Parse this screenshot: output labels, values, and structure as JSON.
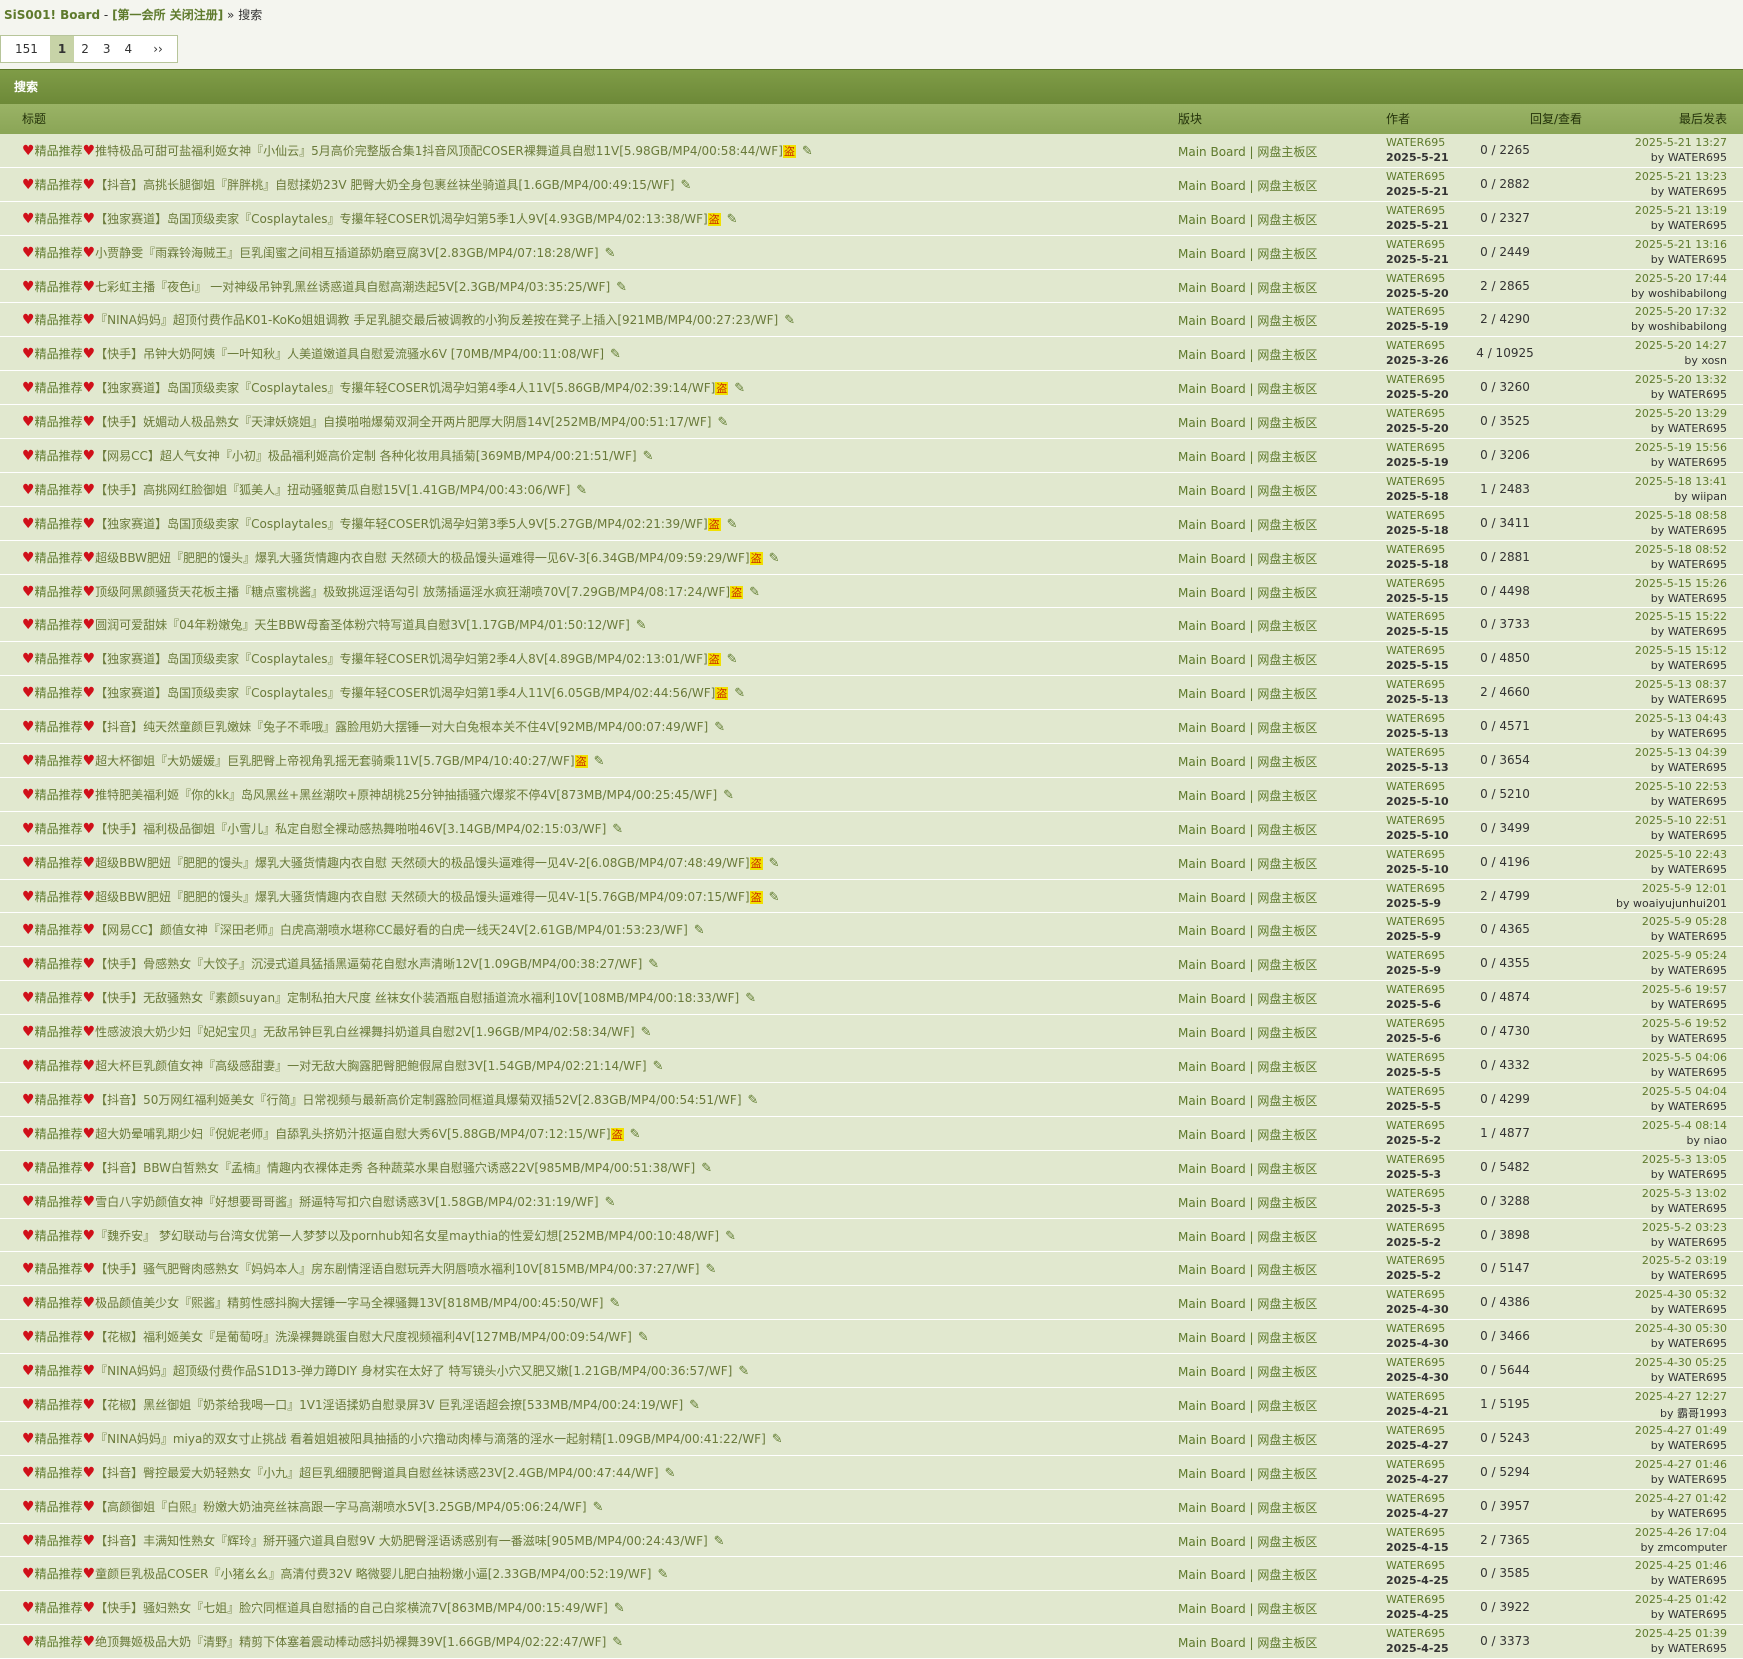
{
  "breadcrumb": {
    "site": "SiS001! Board",
    "sep1": " - ",
    "forum": "[第一会所 关闭注册]",
    "sep2": " » ",
    "current": "搜索"
  },
  "pager": {
    "total": "151",
    "current": "1",
    "pages": [
      "2",
      "3",
      "4"
    ],
    "next": "››"
  },
  "section_title": "搜索",
  "columns": {
    "title": "标题",
    "forum": "版块",
    "author": "作者",
    "stats": "回复/查看",
    "last": "最后发表"
  },
  "row_prefix": "精品推荐",
  "forum_label": "Main Board | 网盘主板区",
  "rows": [
    {
      "title": "推特极品可甜可盐福利姬女神『小仙云』5月高价完整版合集1抖音风顶配COSER裸舞道具自慰11V[5.98GB/MP4/00:58:44/WF]",
      "tag": "盗",
      "author": "WATER695",
      "date": "2025-5-21",
      "stats": "0 / 2265",
      "last_time": "2025-5-21 13:27",
      "last_by": "by WATER695"
    },
    {
      "title": "【抖音】高挑长腿御姐『胖胖桃』自慰揉奶23V 肥臀大奶全身包裹丝袜坐骑道具[1.6GB/MP4/00:49:15/WF]",
      "tag": "",
      "author": "WATER695",
      "date": "2025-5-21",
      "stats": "0 / 2882",
      "last_time": "2025-5-21 13:23",
      "last_by": "by WATER695"
    },
    {
      "title": "【独家赛道】岛国顶级卖家『Cosplaytales』专攥年轻COSER饥渴孕妇第5季1人9V[4.93GB/MP4/02:13:38/WF]",
      "tag": "盗",
      "author": "WATER695",
      "date": "2025-5-21",
      "stats": "0 / 2327",
      "last_time": "2025-5-21 13:19",
      "last_by": "by WATER695"
    },
    {
      "title": "小贾静雯『雨霖铃海贼王』巨乳闺蜜之间相互插道舔奶磨豆腐3V[2.83GB/MP4/07:18:28/WF]",
      "tag": "",
      "author": "WATER695",
      "date": "2025-5-21",
      "stats": "0 / 2449",
      "last_time": "2025-5-21 13:16",
      "last_by": "by WATER695"
    },
    {
      "title": "七彩虹主播『夜色i』 一对神级吊钟乳黑丝诱惑道具自慰高潮迭起5V[2.3GB/MP4/03:35:25/WF]",
      "tag": "",
      "author": "WATER695",
      "date": "2025-5-20",
      "stats": "2 / 2865",
      "last_time": "2025-5-20 17:44",
      "last_by": "by woshibabilong"
    },
    {
      "title": "『NINA妈妈』超顶付费作品K01-KoKo姐姐调教 手足乳腿交最后被调教的小狗反差按在凳子上插入[921MB/MP4/00:27:23/WF]",
      "tag": "",
      "author": "WATER695",
      "date": "2025-5-19",
      "stats": "2 / 4290",
      "last_time": "2025-5-20 17:32",
      "last_by": "by woshibabilong"
    },
    {
      "title": "【快手】吊钟大奶阿姨『一叶知秋』人美道嫩道具自慰爱流骚水6V [70MB/MP4/00:11:08/WF]",
      "tag": "",
      "author": "WATER695",
      "date": "2025-3-26",
      "stats": "4 / 10925",
      "last_time": "2025-5-20 14:27",
      "last_by": "by xosn"
    },
    {
      "title": "【独家赛道】岛国顶级卖家『Cosplaytales』专攥年轻COSER饥渴孕妇第4季4人11V[5.86GB/MP4/02:39:14/WF]",
      "tag": "盗",
      "author": "WATER695",
      "date": "2025-5-20",
      "stats": "0 / 3260",
      "last_time": "2025-5-20 13:32",
      "last_by": "by WATER695"
    },
    {
      "title": "【快手】妩媚动人极品熟女『天津妖娆姐』自摸啪啪爆菊双洞全开两片肥厚大阴唇14V[252MB/MP4/00:51:17/WF]",
      "tag": "",
      "author": "WATER695",
      "date": "2025-5-20",
      "stats": "0 / 3525",
      "last_time": "2025-5-20 13:29",
      "last_by": "by WATER695"
    },
    {
      "title": "【网易CC】超人气女神『小初』极品福利姬高价定制 各种化妆用具插菊[369MB/MP4/00:21:51/WF]",
      "tag": "",
      "author": "WATER695",
      "date": "2025-5-19",
      "stats": "0 / 3206",
      "last_time": "2025-5-19 15:56",
      "last_by": "by WATER695"
    },
    {
      "title": "【快手】高挑网红脸御姐『狐美人』扭动骚躯黄瓜自慰15V[1.41GB/MP4/00:43:06/WF]",
      "tag": "",
      "author": "WATER695",
      "date": "2025-5-18",
      "stats": "1 / 2483",
      "last_time": "2025-5-18 13:41",
      "last_by": "by wiipan"
    },
    {
      "title": "【独家赛道】岛国顶级卖家『Cosplaytales』专攥年轻COSER饥渴孕妇第3季5人9V[5.27GB/MP4/02:21:39/WF]",
      "tag": "盗",
      "author": "WATER695",
      "date": "2025-5-18",
      "stats": "0 / 3411",
      "last_time": "2025-5-18 08:58",
      "last_by": "by WATER695"
    },
    {
      "title": "超级BBW肥妞『肥肥的馒头』爆乳大骚货情趣内衣自慰 天然硕大的极品馒头逼难得一见6V-3[6.34GB/MP4/09:59:29/WF]",
      "tag": "盗",
      "author": "WATER695",
      "date": "2025-5-18",
      "stats": "0 / 2881",
      "last_time": "2025-5-18 08:52",
      "last_by": "by WATER695"
    },
    {
      "title": "顶级阿黑颜骚货天花板主播『糖点蜜桃酱』极致挑逗淫语勾引 放荡插逼淫水疯狂潮喷70V[7.29GB/MP4/08:17:24/WF]",
      "tag": "盗",
      "author": "WATER695",
      "date": "2025-5-15",
      "stats": "0 / 4498",
      "last_time": "2025-5-15 15:26",
      "last_by": "by WATER695"
    },
    {
      "title": "圆润可爱甜妹『04年粉嫩兔』天生BBW母畜圣体粉穴特写道具自慰3V[1.17GB/MP4/01:50:12/WF]",
      "tag": "",
      "author": "WATER695",
      "date": "2025-5-15",
      "stats": "0 / 3733",
      "last_time": "2025-5-15 15:22",
      "last_by": "by WATER695"
    },
    {
      "title": "【独家赛道】岛国顶级卖家『Cosplaytales』专攥年轻COSER饥渴孕妇第2季4人8V[4.89GB/MP4/02:13:01/WF]",
      "tag": "盗",
      "author": "WATER695",
      "date": "2025-5-15",
      "stats": "0 / 4850",
      "last_time": "2025-5-15 15:12",
      "last_by": "by WATER695"
    },
    {
      "title": "【独家赛道】岛国顶级卖家『Cosplaytales』专攥年轻COSER饥渴孕妇第1季4人11V[6.05GB/MP4/02:44:56/WF]",
      "tag": "盗",
      "author": "WATER695",
      "date": "2025-5-13",
      "stats": "2 / 4660",
      "last_time": "2025-5-13 08:37",
      "last_by": "by WATER695"
    },
    {
      "title": "【抖音】纯天然童颜巨乳嫩妹『兔子不乖哦』露脸甩奶大摆锤一对大白兔根本关不住4V[92MB/MP4/00:07:49/WF]",
      "tag": "",
      "author": "WATER695",
      "date": "2025-5-13",
      "stats": "0 / 4571",
      "last_time": "2025-5-13 04:43",
      "last_by": "by WATER695"
    },
    {
      "title": "超大杯御姐『大奶媛媛』巨乳肥臀上帝视角乳摇无套骑乘11V[5.7GB/MP4/10:40:27/WF]",
      "tag": "盗",
      "author": "WATER695",
      "date": "2025-5-13",
      "stats": "0 / 3654",
      "last_time": "2025-5-13 04:39",
      "last_by": "by WATER695"
    },
    {
      "title": "推特肥美福利姬『你的kk』岛风黑丝+黑丝潮吹+原神胡桃25分钟抽插骚穴爆浆不停4V[873MB/MP4/00:25:45/WF]",
      "tag": "",
      "author": "WATER695",
      "date": "2025-5-10",
      "stats": "0 / 5210",
      "last_time": "2025-5-10 22:53",
      "last_by": "by WATER695"
    },
    {
      "title": "【快手】福利极品御姐『小雪儿』私定自慰全裸动感热舞啪啪46V[3.14GB/MP4/02:15:03/WF]",
      "tag": "",
      "author": "WATER695",
      "date": "2025-5-10",
      "stats": "0 / 3499",
      "last_time": "2025-5-10 22:51",
      "last_by": "by WATER695"
    },
    {
      "title": "超级BBW肥妞『肥肥的馒头』爆乳大骚货情趣内衣自慰 天然硕大的极品馒头逼难得一见4V-2[6.08GB/MP4/07:48:49/WF]",
      "tag": "盗",
      "author": "WATER695",
      "date": "2025-5-10",
      "stats": "0 / 4196",
      "last_time": "2025-5-10 22:43",
      "last_by": "by WATER695"
    },
    {
      "title": "超级BBW肥妞『肥肥的馒头』爆乳大骚货情趣内衣自慰 天然硕大的极品馒头逼难得一见4V-1[5.76GB/MP4/09:07:15/WF]",
      "tag": "盗",
      "author": "WATER695",
      "date": "2025-5-9",
      "stats": "2 / 4799",
      "last_time": "2025-5-9 12:01",
      "last_by": "by woaiyujunhui201"
    },
    {
      "title": "【网易CC】颜值女神『深田老师』白虎高潮喷水堪称CC最好看的白虎一线天24V[2.61GB/MP4/01:53:23/WF]",
      "tag": "",
      "author": "WATER695",
      "date": "2025-5-9",
      "stats": "0 / 4365",
      "last_time": "2025-5-9 05:28",
      "last_by": "by WATER695"
    },
    {
      "title": "【快手】骨感熟女『大饺子』沉浸式道具猛插黑逼菊花自慰水声清晰12V[1.09GB/MP4/00:38:27/WF]",
      "tag": "",
      "author": "WATER695",
      "date": "2025-5-9",
      "stats": "0 / 4355",
      "last_time": "2025-5-9 05:24",
      "last_by": "by WATER695"
    },
    {
      "title": "【快手】无敌骚熟女『素颜suyan』定制私拍大尺度 丝袜女仆装酒瓶自慰插道流水福利10V[108MB/MP4/00:18:33/WF]",
      "tag": "",
      "author": "WATER695",
      "date": "2025-5-6",
      "stats": "0 / 4874",
      "last_time": "2025-5-6 19:57",
      "last_by": "by WATER695"
    },
    {
      "title": "性感波浪大奶少妇『妃妃宝贝』无敌吊钟巨乳白丝裸舞抖奶道具自慰2V[1.96GB/MP4/02:58:34/WF]",
      "tag": "",
      "author": "WATER695",
      "date": "2025-5-6",
      "stats": "0 / 4730",
      "last_time": "2025-5-6 19:52",
      "last_by": "by WATER695"
    },
    {
      "title": "超大杯巨乳颜值女神『高级感甜妻』一对无敌大胸露肥臀肥鲍假屌自慰3V[1.54GB/MP4/02:21:14/WF]",
      "tag": "",
      "author": "WATER695",
      "date": "2025-5-5",
      "stats": "0 / 4332",
      "last_time": "2025-5-5 04:06",
      "last_by": "by WATER695"
    },
    {
      "title": "【抖音】50万网红福利姬美女『行简』日常视频与最新高价定制露脸同框道具爆菊双插52V[2.83GB/MP4/00:54:51/WF]",
      "tag": "",
      "author": "WATER695",
      "date": "2025-5-5",
      "stats": "0 / 4299",
      "last_time": "2025-5-5 04:04",
      "last_by": "by WATER695"
    },
    {
      "title": "超大奶晕哺乳期少妇『倪妮老师』自舔乳头挤奶汁抠逼自慰大秀6V[5.88GB/MP4/07:12:15/WF]",
      "tag": "盗",
      "author": "WATER695",
      "date": "2025-5-2",
      "stats": "1 / 4877",
      "last_time": "2025-5-4 08:14",
      "last_by": "by niao"
    },
    {
      "title": "【抖音】BBW白皙熟女『孟楠』情趣内衣裸体走秀 各种蔬菜水果自慰骚穴诱惑22V[985MB/MP4/00:51:38/WF]",
      "tag": "",
      "author": "WATER695",
      "date": "2025-5-3",
      "stats": "0 / 5482",
      "last_time": "2025-5-3 13:05",
      "last_by": "by WATER695"
    },
    {
      "title": "雪白八字奶颜值女神『好想要哥哥酱』掰逼特写扣穴自慰诱惑3V[1.58GB/MP4/02:31:19/WF]",
      "tag": "",
      "author": "WATER695",
      "date": "2025-5-3",
      "stats": "0 / 3288",
      "last_time": "2025-5-3 13:02",
      "last_by": "by WATER695"
    },
    {
      "title": "『魏乔安』 梦幻联动与台湾女优第一人梦梦以及pornhub知名女星maythia的性爱幻想[252MB/MP4/00:10:48/WF]",
      "tag": "",
      "author": "WATER695",
      "date": "2025-5-2",
      "stats": "0 / 3898",
      "last_time": "2025-5-2 03:23",
      "last_by": "by WATER695"
    },
    {
      "title": "【快手】骚气肥臀肉感熟女『妈妈本人』房东剧情淫语自慰玩弄大阴唇喷水福利10V[815MB/MP4/00:37:27/WF]",
      "tag": "",
      "author": "WATER695",
      "date": "2025-5-2",
      "stats": "0 / 5147",
      "last_time": "2025-5-2 03:19",
      "last_by": "by WATER695"
    },
    {
      "title": "极品颜值美少女『熙酱』精剪性感抖胸大摆锤一字马全裸骚舞13V[818MB/MP4/00:45:50/WF]",
      "tag": "",
      "author": "WATER695",
      "date": "2025-4-30",
      "stats": "0 / 4386",
      "last_time": "2025-4-30 05:32",
      "last_by": "by WATER695"
    },
    {
      "title": "【花椒】福利姬美女『是葡萄呀』洗澡裸舞跳蛋自慰大尺度视频福利4V[127MB/MP4/00:09:54/WF]",
      "tag": "",
      "author": "WATER695",
      "date": "2025-4-30",
      "stats": "0 / 3466",
      "last_time": "2025-4-30 05:30",
      "last_by": "by WATER695"
    },
    {
      "title": "『NINA妈妈』超顶级付费作品S1D13-弹力蹲DIY 身材实在太好了 特写镜头小穴又肥又嫩[1.21GB/MP4/00:36:57/WF]",
      "tag": "",
      "author": "WATER695",
      "date": "2025-4-30",
      "stats": "0 / 5644",
      "last_time": "2025-4-30 05:25",
      "last_by": "by WATER695"
    },
    {
      "title": "【花椒】黑丝御姐『奶茶给我喝一口』1V1淫语揉奶自慰录屏3V 巨乳淫语超会撩[533MB/MP4/00:24:19/WF]",
      "tag": "",
      "author": "WATER695",
      "date": "2025-4-21",
      "stats": "1 / 5195",
      "last_time": "2025-4-27 12:27",
      "last_by": "by 霸哥1993"
    },
    {
      "title": "『NINA妈妈』miya的双女寸止挑战 看着姐姐被阳具抽插的小穴撸动肉棒与滴落的淫水一起射精[1.09GB/MP4/00:41:22/WF]",
      "tag": "",
      "author": "WATER695",
      "date": "2025-4-27",
      "stats": "0 / 5243",
      "last_time": "2025-4-27 01:49",
      "last_by": "by WATER695"
    },
    {
      "title": "【抖音】臀控最爱大奶轻熟女『小九』超巨乳细腰肥臀道具自慰丝袜诱惑23V[2.4GB/MP4/00:47:44/WF]",
      "tag": "",
      "author": "WATER695",
      "date": "2025-4-27",
      "stats": "0 / 5294",
      "last_time": "2025-4-27 01:46",
      "last_by": "by WATER695"
    },
    {
      "title": "【高颜御姐『白熙』粉嫩大奶油亮丝袜高跟一字马高潮喷水5V[3.25GB/MP4/05:06:24/WF]",
      "tag": "",
      "author": "WATER695",
      "date": "2025-4-27",
      "stats": "0 / 3957",
      "last_time": "2025-4-27 01:42",
      "last_by": "by WATER695"
    },
    {
      "title": "【抖音】丰满知性熟女『辉玲』掰开骚穴道具自慰9V 大奶肥臀淫语诱惑别有一番滋味[905MB/MP4/00:24:43/WF]",
      "tag": "",
      "author": "WATER695",
      "date": "2025-4-15",
      "stats": "2 / 7365",
      "last_time": "2025-4-26 17:04",
      "last_by": "by zmcomputer"
    },
    {
      "title": "童颜巨乳极品COSER『小猪幺幺』高清付费32V 略微婴儿肥白抽粉嫩小逼[2.33GB/MP4/00:52:19/WF]",
      "tag": "",
      "author": "WATER695",
      "date": "2025-4-25",
      "stats": "0 / 3585",
      "last_time": "2025-4-25 01:46",
      "last_by": "by WATER695"
    },
    {
      "title": "【快手】骚妇熟女『七姐』脸穴同框道具自慰插的自己白浆横流7V[863MB/MP4/00:15:49/WF]",
      "tag": "",
      "author": "WATER695",
      "date": "2025-4-25",
      "stats": "0 / 3922",
      "last_time": "2025-4-25 01:42",
      "last_by": "by WATER695"
    },
    {
      "title": "绝顶舞姬极品大奶『清野』精剪下体塞着震动棒动感抖奶裸舞39V[1.66GB/MP4/02:22:47/WF]",
      "tag": "",
      "author": "WATER695",
      "date": "2025-4-25",
      "stats": "0 / 3373",
      "last_time": "2025-4-25 01:39",
      "last_by": "by WATER695"
    }
  ]
}
